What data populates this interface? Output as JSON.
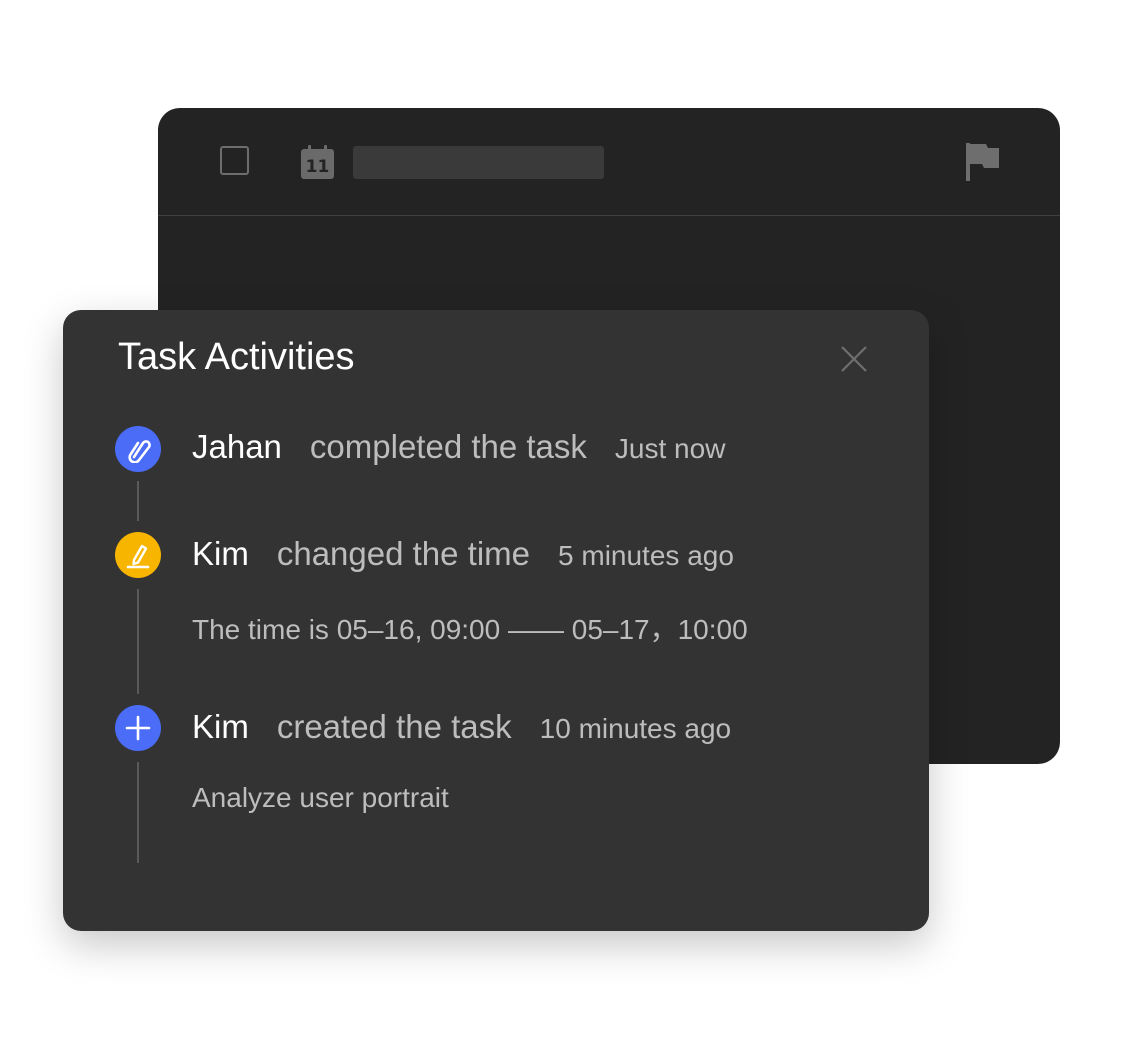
{
  "colors": {
    "back_card": "#232323",
    "panel": "#333333",
    "blue_accent": "#4a6cf7",
    "amber_accent": "#f7b500"
  },
  "back_card": {
    "icons": [
      "checkbox-icon",
      "calendar-icon",
      "flag-icon"
    ],
    "calendar_day": "11"
  },
  "panel": {
    "title": "Task Activities",
    "close_icon": "close-icon"
  },
  "activities": [
    {
      "icon": "attachment-icon",
      "icon_color": "#4a6cf7",
      "user": "Jahan",
      "action": "completed the task",
      "time": "Just now",
      "detail": ""
    },
    {
      "icon": "pencil-icon",
      "icon_color": "#f7b500",
      "user": "Kim",
      "action": "changed the time",
      "time": "5 minutes ago",
      "detail": "The time is 05–16, 09:00 —— 05–17，10:00"
    },
    {
      "icon": "plus-icon",
      "icon_color": "#4a6cf7",
      "user": "Kim",
      "action": "created the task",
      "time": "10 minutes ago",
      "detail": "Analyze user portrait"
    }
  ]
}
